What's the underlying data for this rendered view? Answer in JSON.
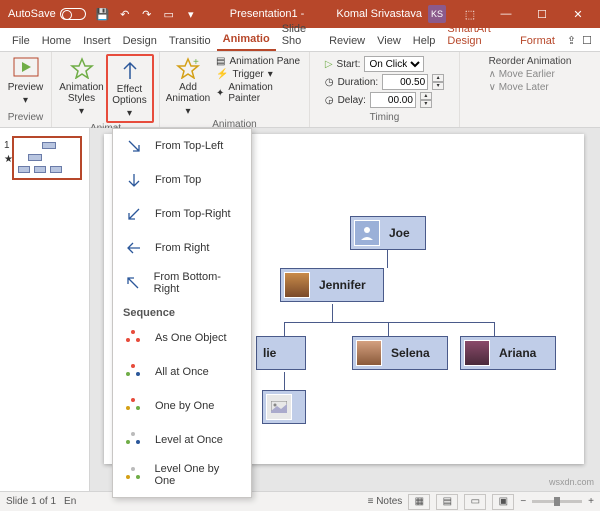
{
  "titlebar": {
    "autosave": "AutoSave",
    "doc": "Presentation1 -",
    "user": "Komal Srivastava",
    "initials": "KS"
  },
  "tabs": [
    "File",
    "Home",
    "Insert",
    "Design",
    "Transitio",
    "Animatio",
    "Slide Sho",
    "Review",
    "View",
    "Help",
    "SmartArt Design",
    "Format"
  ],
  "ribbon": {
    "preview": "Preview",
    "preview_grp": "Preview",
    "animstyles": "Animation Styles",
    "effect": "Effect Options",
    "anim_grp": "Animat",
    "addanim": "Add Animation",
    "pane": "Animation Pane",
    "trigger": "Trigger",
    "painter": "Animation Painter",
    "adv_grp": "Animation",
    "start": "Start:",
    "start_val": "On Click",
    "duration": "Duration:",
    "duration_val": "00.50",
    "delay": "Delay:",
    "delay_val": "00.00",
    "timing_grp": "Timing",
    "reorder": "Reorder Animation",
    "earlier": "Move Earlier",
    "later": "Move Later"
  },
  "dropdown": {
    "dirs": [
      "From Top-Left",
      "From Top",
      "From Top-Right",
      "From Right",
      "From Bottom-Right"
    ],
    "seq_hdr": "Sequence",
    "seq": [
      "As One Object",
      "All at Once",
      "One by One",
      "Level at Once",
      "Level One by One"
    ]
  },
  "chart_data": {
    "type": "org",
    "nodes": [
      {
        "id": "joe",
        "name": "Joe"
      },
      {
        "id": "jennifer",
        "name": "Jennifer"
      },
      {
        "id": "lie",
        "name": "lie"
      },
      {
        "id": "selena",
        "name": "Selena"
      },
      {
        "id": "ariana",
        "name": "Ariana"
      },
      {
        "id": "blank",
        "name": ""
      }
    ]
  },
  "status": {
    "slide": "Slide 1 of 1",
    "lang": "En",
    "notes": "Notes"
  },
  "watermark": "wsxdn.com"
}
